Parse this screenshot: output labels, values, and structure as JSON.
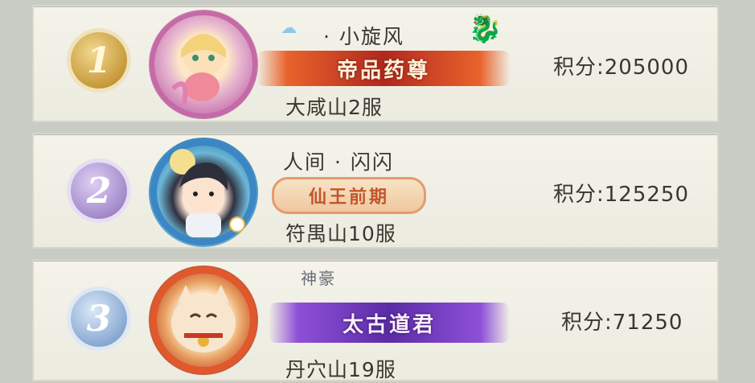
{
  "entries": [
    {
      "rank": "1",
      "name": "· 小旋风",
      "title": "帝品药尊",
      "server": "大咸山2服",
      "score_label": "积分:",
      "score": "205000",
      "badge_color": "#c79a3b"
    },
    {
      "rank": "2",
      "name": "人间 · 闪闪",
      "title": "仙王前期",
      "server": "符禺山10服",
      "score_label": "积分:",
      "score": "125250",
      "badge_color": "#a48acb"
    },
    {
      "rank": "3",
      "name": "神豪",
      "title": "太古道君",
      "server": "丹穴山19服",
      "score_label": "积分:",
      "score": "71250",
      "badge_color": "#89a9d3"
    }
  ],
  "icons": {
    "rank_badge": "rank-medal-icon",
    "avatar": "player-portrait",
    "cloud": "cloud-icon",
    "dragon": "dragon-icon"
  }
}
